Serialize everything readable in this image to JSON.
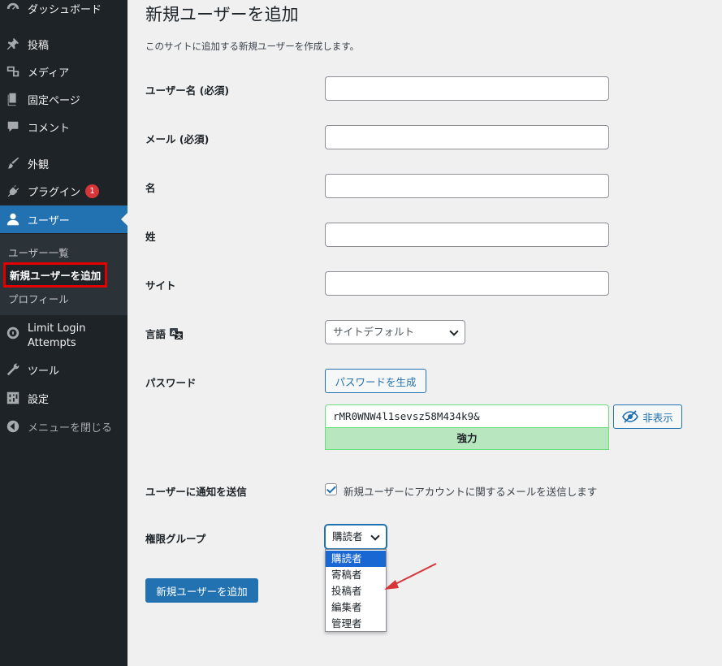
{
  "sidebar": {
    "items": [
      {
        "label": "ダッシュボード",
        "icon": "dashboard-icon"
      },
      {
        "label": "投稿",
        "icon": "pin-icon"
      },
      {
        "label": "メディア",
        "icon": "media-icon"
      },
      {
        "label": "固定ページ",
        "icon": "page-icon"
      },
      {
        "label": "コメント",
        "icon": "comment-icon"
      },
      {
        "label": "外観",
        "icon": "brush-icon"
      },
      {
        "label": "プラグイン",
        "icon": "plugin-icon",
        "badge": "1"
      },
      {
        "label": "ユーザー",
        "icon": "user-icon",
        "active": true
      },
      {
        "label": "Limit Login Attempts",
        "icon": "limit-login-icon"
      },
      {
        "label": "ツール",
        "icon": "wrench-icon"
      },
      {
        "label": "設定",
        "icon": "settings-icon"
      },
      {
        "label": "メニューを閉じる",
        "icon": "collapse-icon"
      }
    ],
    "submenu": [
      {
        "label": "ユーザー一覧"
      },
      {
        "label": "新規ユーザーを追加",
        "current": true
      },
      {
        "label": "プロフィール"
      }
    ]
  },
  "main": {
    "title": "新規ユーザーを追加",
    "description": "このサイトに追加する新規ユーザーを作成します。",
    "fields": {
      "username_label": "ユーザー名 (必須)",
      "email_label": "メール (必須)",
      "firstname_label": "名",
      "lastname_label": "姓",
      "site_label": "サイト",
      "language_label": "言語",
      "language_value": "サイトデフォルト",
      "password_label": "パスワード",
      "generate_password_label": "パスワードを生成",
      "password_value": "rMR0WNW4l1sevsz58M434k9&",
      "hide_label": "非表示",
      "strength_label": "強力",
      "notify_label": "ユーザーに通知を送信",
      "notify_text": "新規ユーザーにアカウントに関するメールを送信します",
      "notify_checked": true,
      "role_label": "権限グループ",
      "role_value": "購読者",
      "role_options": [
        "購読者",
        "寄稿者",
        "投稿者",
        "編集者",
        "管理者"
      ]
    },
    "submit_label": "新規ユーザーを追加"
  },
  "colors": {
    "sidebar_bg": "#1d2327",
    "accent": "#2271b1",
    "highlight_border": "#e00000",
    "strength_bg": "#b8e6bf",
    "arrow": "#d63638"
  }
}
